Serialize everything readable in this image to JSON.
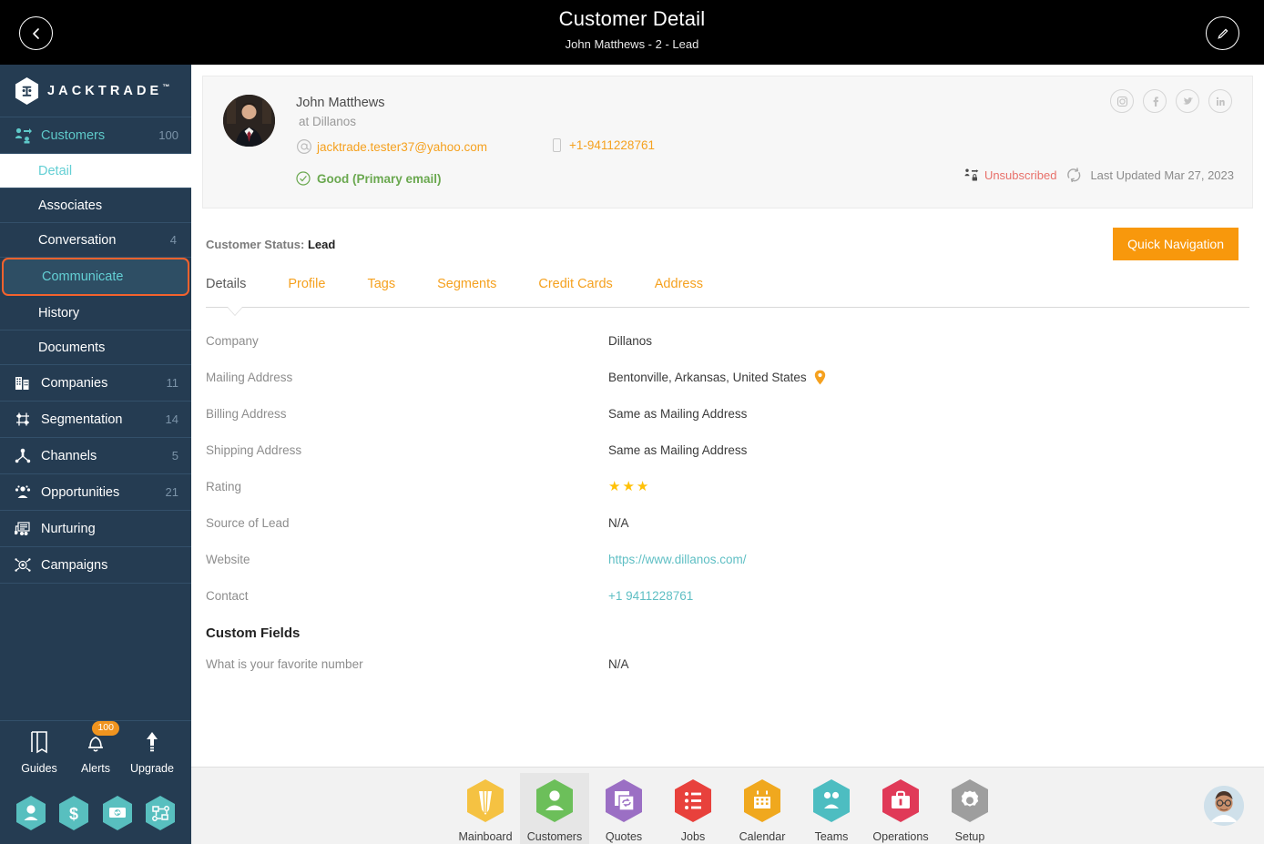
{
  "header": {
    "title": "Customer Detail",
    "subtitle": "John Matthews - 2 - Lead",
    "back_icon": "chevron-left-icon",
    "edit_icon": "pencil-icon"
  },
  "brand": {
    "name": "JACKTRADE",
    "tm": "™"
  },
  "sidebar": {
    "items": [
      {
        "label": "Customers",
        "count": "100",
        "icon": "customers-icon",
        "type": "primary"
      },
      {
        "label": "Detail",
        "count": "",
        "type": "sub",
        "state": "active"
      },
      {
        "label": "Associates",
        "count": "",
        "type": "sub"
      },
      {
        "label": "Conversation",
        "count": "4",
        "type": "sub"
      },
      {
        "label": "Communicate",
        "count": "",
        "type": "sub",
        "state": "highlight"
      },
      {
        "label": "History",
        "count": "",
        "type": "sub"
      },
      {
        "label": "Documents",
        "count": "",
        "type": "sub"
      },
      {
        "label": "Companies",
        "count": "11",
        "icon": "building-icon",
        "type": "nav"
      },
      {
        "label": "Segmentation",
        "count": "14",
        "icon": "segmentation-icon",
        "type": "nav"
      },
      {
        "label": "Channels",
        "count": "5",
        "icon": "channels-icon",
        "type": "nav"
      },
      {
        "label": "Opportunities",
        "count": "21",
        "icon": "opportunities-icon",
        "type": "nav"
      },
      {
        "label": "Nurturing",
        "count": "",
        "icon": "nurturing-icon",
        "type": "nav"
      },
      {
        "label": "Campaigns",
        "count": "",
        "icon": "campaigns-icon",
        "type": "nav"
      }
    ],
    "tools": [
      {
        "label": "Guides",
        "icon": "book-icon",
        "badge": ""
      },
      {
        "label": "Alerts",
        "icon": "bell-icon",
        "badge": "100"
      },
      {
        "label": "Upgrade",
        "icon": "upload-arrow-icon",
        "badge": ""
      }
    ],
    "hex_shortcuts": [
      {
        "icon": "person-hex-icon"
      },
      {
        "icon": "dollar-hex-icon"
      },
      {
        "icon": "money-hex-icon"
      },
      {
        "icon": "workflow-hex-icon"
      }
    ]
  },
  "customer_card": {
    "name": "John Matthews",
    "company_line": "at Dillanos",
    "email": "jacktrade.tester37@yahoo.com",
    "phone": "+1-9411228761",
    "email_status": "Good (Primary email)",
    "subscription_status": "Unsubscribed",
    "last_updated": "Last Updated Mar 27, 2023",
    "socials": [
      {
        "name": "instagram-icon",
        "glyph": "▣"
      },
      {
        "name": "facebook-icon",
        "glyph": "f"
      },
      {
        "name": "twitter-icon",
        "glyph": "✈"
      },
      {
        "name": "linkedin-icon",
        "glyph": "in"
      }
    ]
  },
  "status": {
    "label": "Customer Status:",
    "value": "Lead",
    "quick_navigation": "Quick Navigation"
  },
  "tabs": [
    {
      "label": "Details",
      "active": true
    },
    {
      "label": "Profile",
      "active": false
    },
    {
      "label": "Tags",
      "active": false
    },
    {
      "label": "Segments",
      "active": false
    },
    {
      "label": "Credit Cards",
      "active": false
    },
    {
      "label": "Address",
      "active": false
    }
  ],
  "details": [
    {
      "label": "Company",
      "value": "Dillanos",
      "kind": "text"
    },
    {
      "label": "Mailing Address",
      "value": "Bentonville, Arkansas, United States",
      "kind": "address"
    },
    {
      "label": "Billing Address",
      "value": "Same as Mailing Address",
      "kind": "text"
    },
    {
      "label": "Shipping Address",
      "value": "Same as Mailing Address",
      "kind": "text"
    },
    {
      "label": "Rating",
      "value": "★★★",
      "kind": "stars"
    },
    {
      "label": "Source of Lead",
      "value": "N/A",
      "kind": "text"
    },
    {
      "label": "Website",
      "value": "https://www.dillanos.com/",
      "kind": "link"
    },
    {
      "label": "Contact",
      "value": "+1 9411228761",
      "kind": "link"
    }
  ],
  "custom_fields": {
    "heading": "Custom Fields",
    "rows": [
      {
        "label": "What is your favorite number",
        "value": "N/A",
        "kind": "text"
      }
    ]
  },
  "taskbar": {
    "items": [
      {
        "label": "Mainboard",
        "icon": "mainboard-icon",
        "color": "#f5c242",
        "active": false
      },
      {
        "label": "Customers",
        "icon": "customers-icon",
        "color": "#6cbf5a",
        "active": true
      },
      {
        "label": "Quotes",
        "icon": "quotes-icon",
        "color": "#9b6fc4",
        "active": false
      },
      {
        "label": "Jobs",
        "icon": "jobs-icon",
        "color": "#e8413c",
        "active": false
      },
      {
        "label": "Calendar",
        "icon": "calendar-icon",
        "color": "#f0a81e",
        "active": false
      },
      {
        "label": "Teams",
        "icon": "teams-icon",
        "color": "#4dbdc1",
        "active": false
      },
      {
        "label": "Operations",
        "icon": "operations-icon",
        "color": "#e03a58",
        "active": false
      },
      {
        "label": "Setup",
        "icon": "setup-icon",
        "color": "#9e9e9e",
        "active": false
      }
    ],
    "profile_avatar": "user-avatar"
  },
  "colors": {
    "accent_orange": "#f8980c",
    "link_orange": "#f5a11f",
    "sidebar_bg": "#253c52",
    "teal": "#5fbfc4",
    "highlight_border": "#f4622d",
    "good_green": "#6aa84f",
    "unsub_red": "#e8706a"
  }
}
